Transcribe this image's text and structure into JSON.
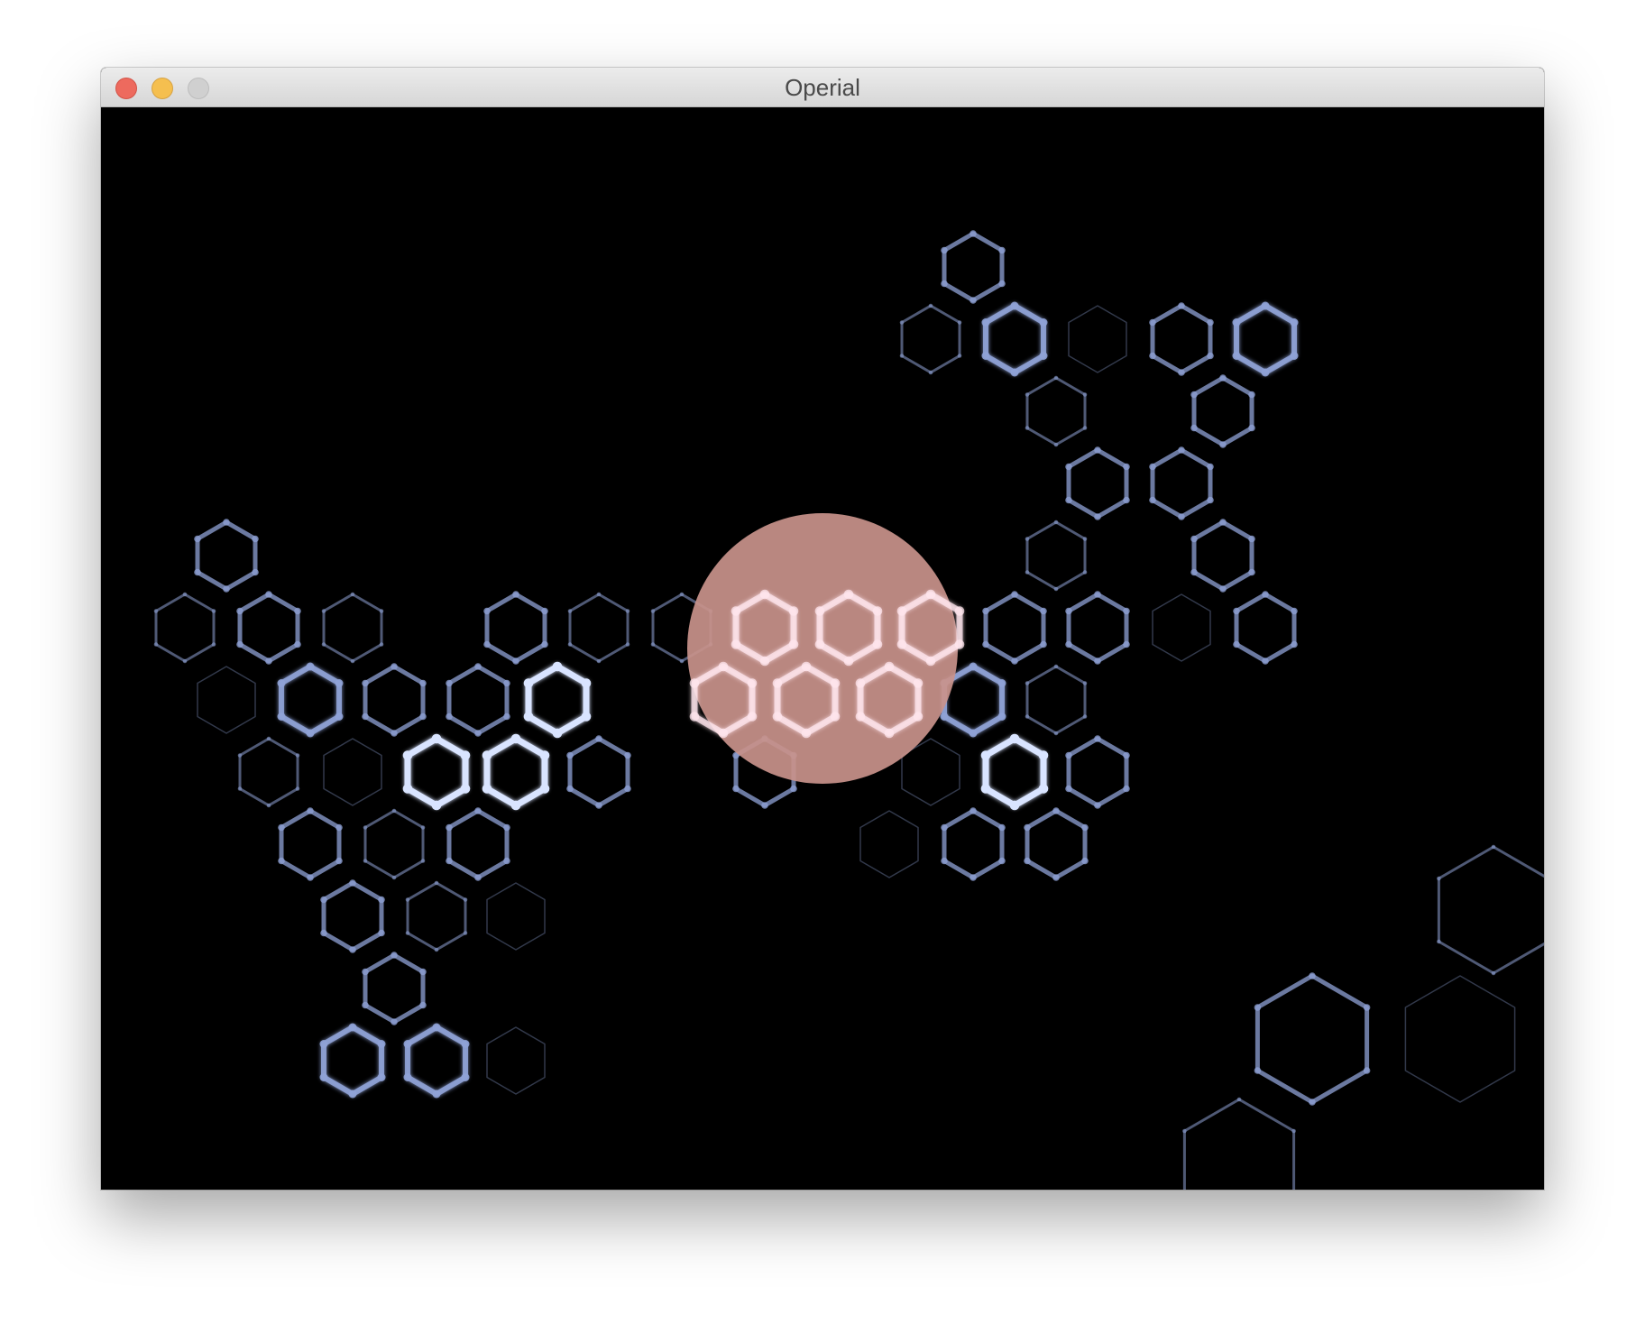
{
  "window": {
    "title": "Operial",
    "controls": [
      "close-button",
      "minimize-button",
      "zoom-button"
    ]
  },
  "game": {
    "background": "#000000",
    "hex_color": "#8fa2d6",
    "hex_color_bright": "#d9e4ff",
    "orb_color": "#c9938b",
    "hex_count": 62,
    "orb_count": 1
  }
}
